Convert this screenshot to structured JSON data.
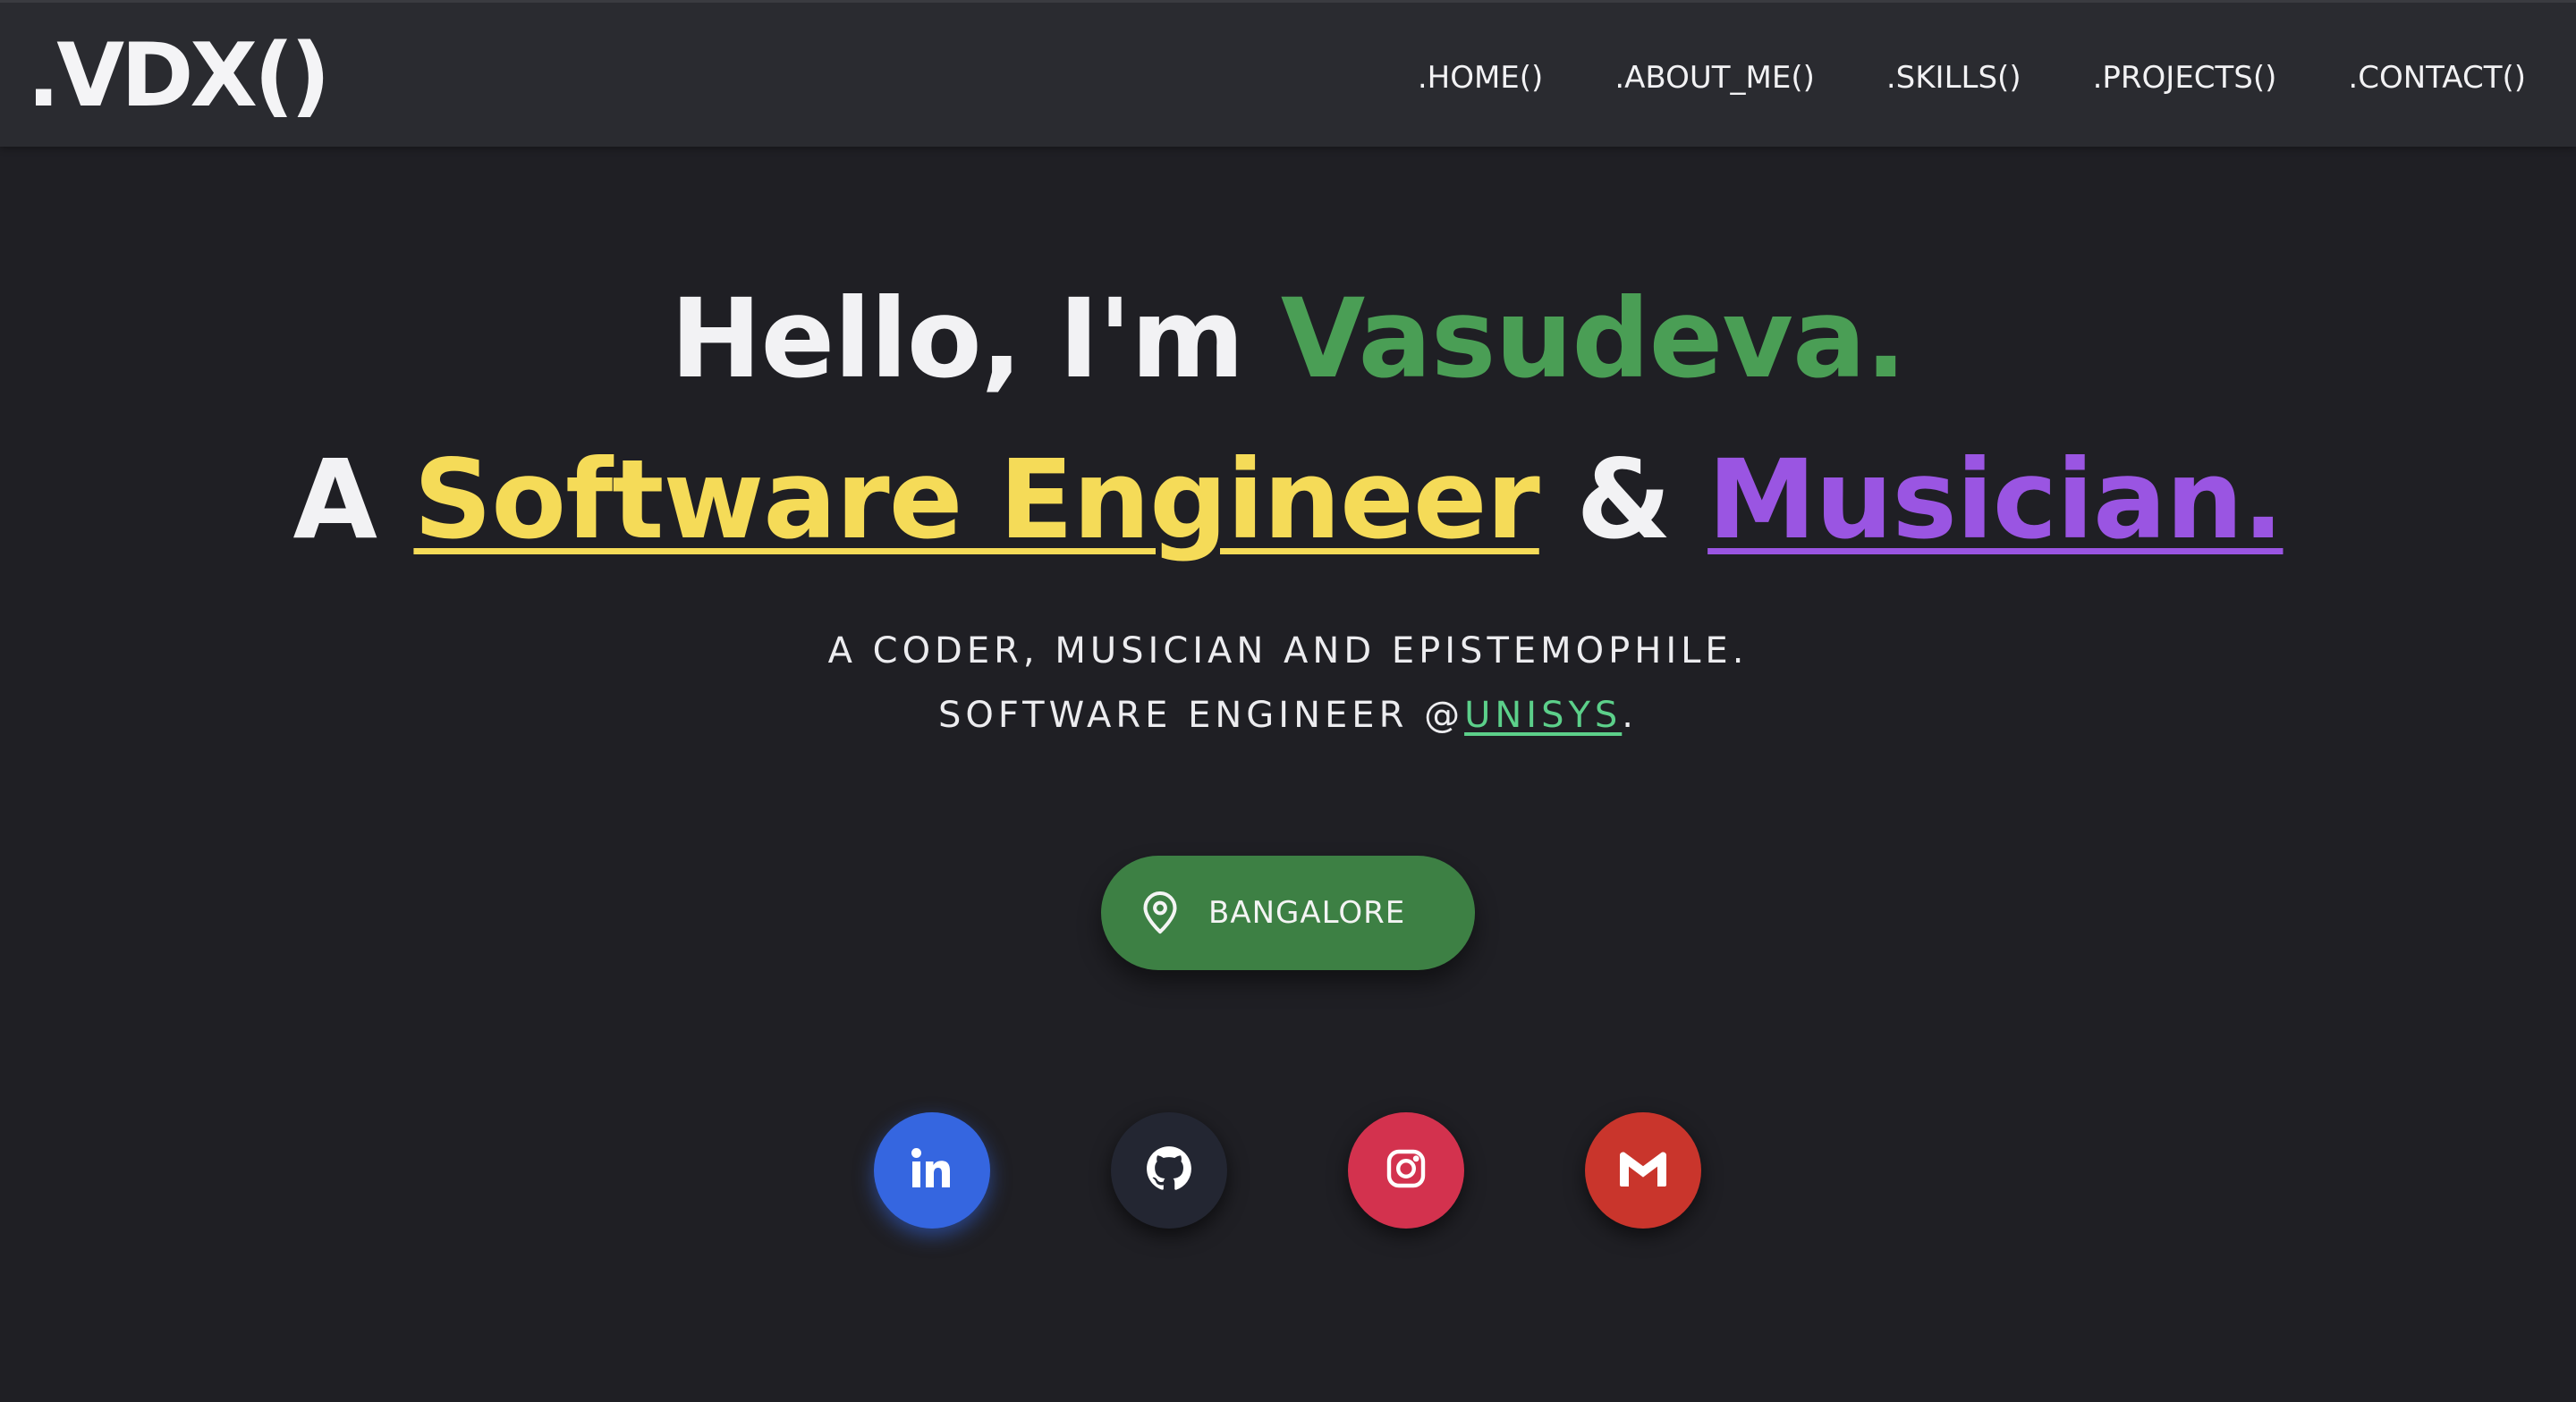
{
  "nav": {
    "logo": ".VDX()",
    "links": [
      ".HOME()",
      ".ABOUT_ME()",
      ".SKILLS()",
      ".PROJECTS()",
      ".CONTACT()"
    ]
  },
  "hero": {
    "greeting_prefix": "Hello, I'm ",
    "name": "Vasudeva.",
    "role_prefix": "A ",
    "role1": "Software Engineer",
    "role_joiner": " & ",
    "role2": "Musician.",
    "tagline1": "A CODER, MUSICIAN AND EPISTEMOPHILE.",
    "tagline2_prefix": "SOFTWARE ENGINEER @",
    "employer": "UNISYS",
    "tagline2_suffix": "."
  },
  "location": {
    "label": "BANGALORE",
    "icon": "map-pin-icon"
  },
  "socials": [
    {
      "name": "linkedin",
      "icon": "linkedin-icon",
      "color": "#3566e0"
    },
    {
      "name": "github",
      "icon": "github-icon",
      "color": "#232632"
    },
    {
      "name": "instagram",
      "icon": "instagram-icon",
      "color": "#d3324e"
    },
    {
      "name": "gmail",
      "icon": "gmail-icon",
      "color": "#c9352c"
    }
  ],
  "colors": {
    "background": "#1f1f24",
    "navbar": "#2a2b30",
    "name_green": "#4a9e55",
    "role_yellow": "#f5db58",
    "role_purple": "#9a55e2",
    "link_green": "#5cd08a",
    "location_button": "#3d8044"
  }
}
